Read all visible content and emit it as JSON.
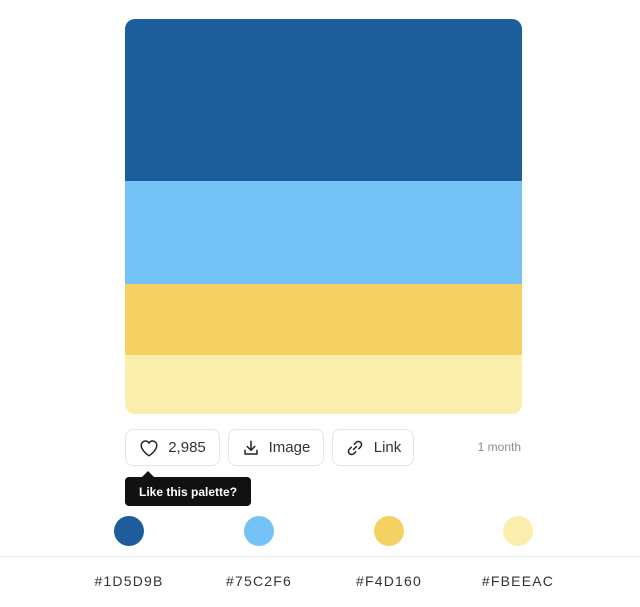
{
  "palette": {
    "colors": [
      {
        "hex": "#1D5D9B",
        "fill": "#1D5D9B"
      },
      {
        "hex": "#75C2F6",
        "fill": "#75C2F6"
      },
      {
        "hex": "#F4D160",
        "fill": "#F4D160"
      },
      {
        "hex": "#FBEEAC",
        "fill": "#FBEEAC"
      }
    ]
  },
  "actions": {
    "like_count": "2,985",
    "image_label": "Image",
    "link_label": "Link",
    "age": "1 month",
    "like_tooltip": "Like this palette?"
  },
  "icons": {
    "like": "heart-icon",
    "image": "download-icon",
    "link": "link-icon"
  }
}
